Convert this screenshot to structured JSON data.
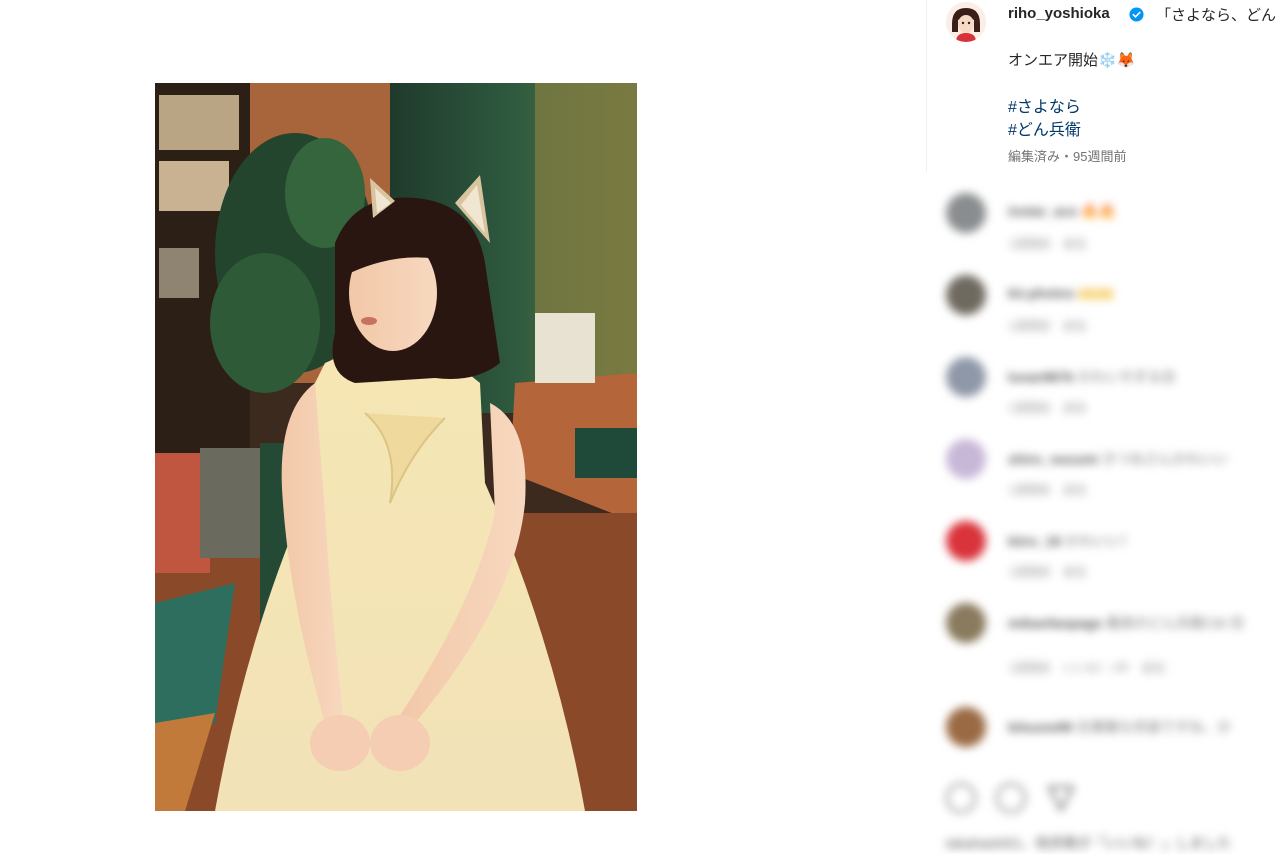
{
  "post": {
    "username": "riho_yoshioka",
    "caption_first": "「さよなら、どん",
    "caption_line2": "オンエア開始❄️🦊",
    "hashtags": [
      "#さよなら",
      "#どん兵衛"
    ],
    "meta": "編集済み・95週間前"
  },
  "comments": [
    {
      "user": "instar_ace",
      "text": "🔥🔥",
      "meta": "1週間前　返信"
    },
    {
      "user": "kir.photos",
      "text": "🙌🙌",
      "meta": "1週間前　返信"
    },
    {
      "user": "lunar9876",
      "text": "かわいすぎる😍",
      "meta": "1週間前　返信"
    },
    {
      "user": "shiro_nezumi",
      "text": "きつねさんかわいい",
      "meta": "1週間前　返信"
    },
    {
      "user": "kiiro_18",
      "text": "かわいい！",
      "meta": "1週間前　返信"
    },
    {
      "user": "mikanfanpage",
      "text": "最高のどん兵衛CM 😍",
      "meta": "1週間前　いいね！1件　返信"
    },
    {
      "user": "kitsune99",
      "text": "😍素敵な衣装ですね、か",
      "meta": "1週間前　返信"
    }
  ],
  "liked_by": "takahashi01、他多数が「いいね！」しました",
  "colors": {
    "link": "#00376b",
    "verified": "#0095f6",
    "meta_text": "#737373"
  },
  "icons": [
    "verified-badge-icon",
    "heart-icon",
    "comment-icon",
    "share-icon"
  ]
}
